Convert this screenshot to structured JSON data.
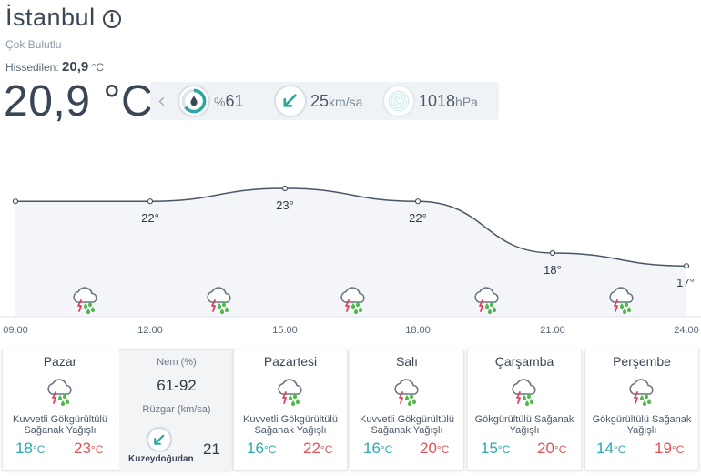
{
  "header": {
    "city": "İstanbul",
    "condition": "Çok Bulutlu",
    "feels_label": "Hissedilen:",
    "feels_value": "20,9",
    "feels_unit": "°C",
    "temperature": "20,9 °C"
  },
  "stats": {
    "humidity_prefix": "%",
    "humidity_value": "61",
    "wind_value": "25",
    "wind_unit": "km/sa",
    "pressure_value": "1018",
    "pressure_unit": "hPa"
  },
  "chart_data": {
    "type": "line",
    "x": [
      "09.00",
      "12.00",
      "15.00",
      "18.00",
      "21.00",
      "24.00"
    ],
    "values": [
      22,
      22,
      23,
      22,
      18,
      17
    ],
    "point_labels": [
      "",
      "22°",
      "23°",
      "22°",
      "18°",
      "17°"
    ],
    "icons": [
      "thunderstorm-rain-icon",
      "thunderstorm-rain-icon",
      "thunderstorm-rain-icon",
      "thunderstorm-rain-icon",
      "thunderstorm-rain-icon"
    ]
  },
  "forecast": [
    {
      "day": "Pazar",
      "desc1": "Kuvvetli Gökgürültülü",
      "desc2": "Sağanak Yağışlı",
      "min": "18",
      "max": "23",
      "unit": "°C"
    },
    {
      "day": "Pazartesi",
      "desc1": "Kuvvetli Gökgürültülü",
      "desc2": "Sağanak Yağışlı",
      "min": "16",
      "max": "22",
      "unit": "°C"
    },
    {
      "day": "Salı",
      "desc1": "Kuvvetli Gökgürültülü",
      "desc2": "Sağanak Yağışlı",
      "min": "16",
      "max": "20",
      "unit": "°C"
    },
    {
      "day": "Çarşamba",
      "desc1": "Gökgürültülü Sağanak",
      "desc2": "Yağışlı",
      "min": "15",
      "max": "20",
      "unit": "°C"
    },
    {
      "day": "Perşembe",
      "desc1": "Gökgürültülü Sağanak",
      "desc2": "Yağışlı",
      "min": "14",
      "max": "19",
      "unit": "°C"
    }
  ],
  "detail": {
    "humidity_label": "Nem (%)",
    "humidity_value": "61-92",
    "wind_label": "Rüzgar (km/sa)",
    "wind_direction": "Kuzeydoğudan",
    "wind_value": "21"
  },
  "colors": {
    "min_temp": "#29aab2",
    "max_temp": "#e05258",
    "humidity_ring": "#2aa7a0",
    "wind_arrow": "#2aa7a0",
    "lightning": "#e0405a",
    "rain_drops": "#4fb848"
  }
}
